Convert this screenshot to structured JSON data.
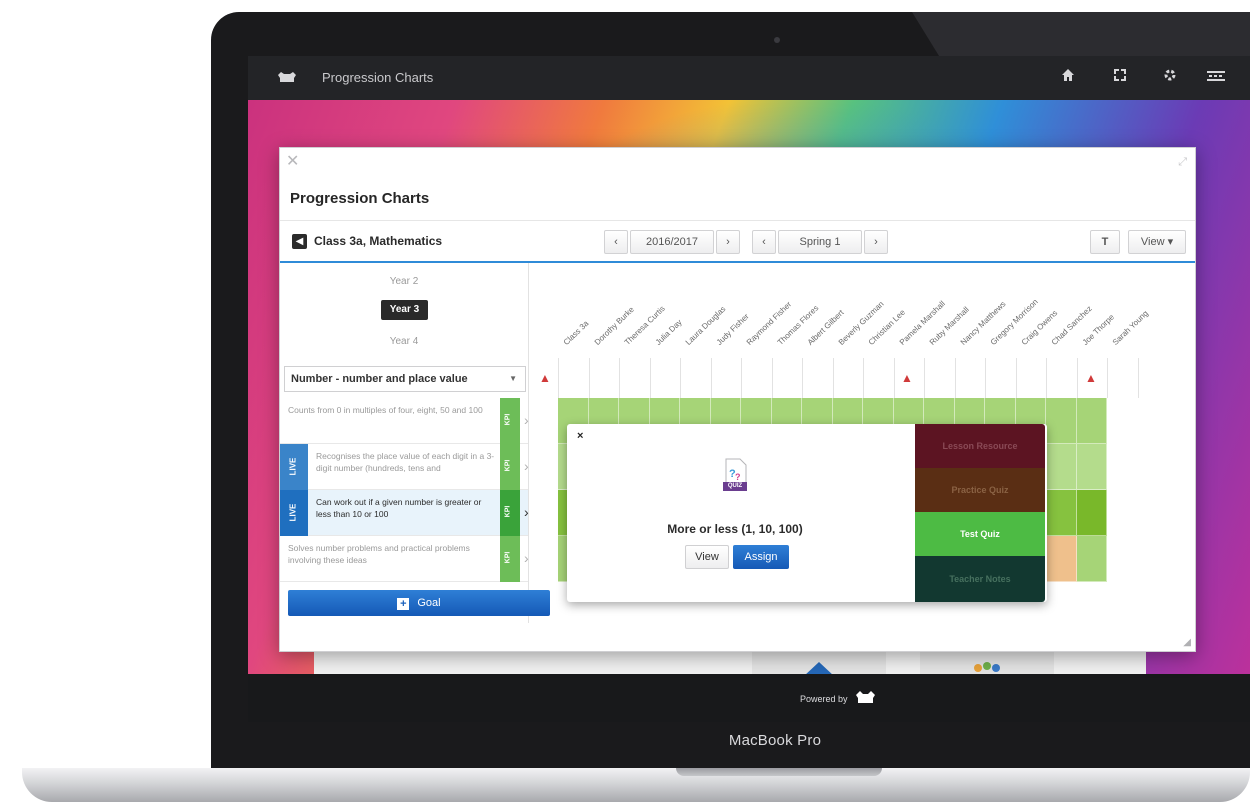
{
  "laptop": {
    "brand": "MacBook Pro"
  },
  "topbar": {
    "title": "Progression Charts",
    "icons": [
      "home-icon",
      "expand-icon",
      "settings-icon",
      "grid-icon"
    ]
  },
  "footer": {
    "powered_by": "Powered by"
  },
  "modal": {
    "title": "Progression Charts",
    "class_label": "Class 3a, Mathematics",
    "year_period": "2016/2017",
    "term": "Spring 1",
    "prev": "‹",
    "next": "›",
    "filter_label": "T",
    "view_label": "View ▾",
    "years": [
      "Year 2",
      "Year 3",
      "Year 4"
    ],
    "active_year": "Year 3",
    "topic": "Number - number and place value",
    "objectives": [
      {
        "text": "Counts from 0 in multiples of four, eight, 50 and 100",
        "live": false,
        "tag": "KPI"
      },
      {
        "text": "Recognises the place value of each digit in a 3-digit number (hundreds, tens and",
        "live": true,
        "tag": "KPI",
        "live_label": "LIVE"
      },
      {
        "text": "Can work out if a given number is greater or less than 10 or 100",
        "live": true,
        "tag": "KPI",
        "live_label": "LIVE"
      },
      {
        "text": "Solves number problems and practical problems involving these ideas",
        "live": false,
        "tag": "KPI"
      }
    ],
    "goal_label": "Goal",
    "students": [
      "Class 3a",
      "Dorothy Burke",
      "Theresa Curtis",
      "Julia Day",
      "Laura Douglas",
      "Judy Fisher",
      "Raymond Fisher",
      "Thomas Flores",
      "Albert Gilbert",
      "Beverly Guzman",
      "Christian Lee",
      "Pamela Marshall",
      "Ruby Marshall",
      "Nancy Matthews",
      "Gregory Morrison",
      "Craig Owens",
      "Chad Sanchez",
      "Joe Thorpe",
      "Sarah Young"
    ]
  },
  "popover": {
    "close": "×",
    "badge": "QUIZ",
    "title": "More or less (1, 10, 100)",
    "view_label": "View",
    "assign_label": "Assign",
    "resources": [
      {
        "label": "Lesson Resource",
        "color": "#5c1422",
        "text_color": "#8a4a56"
      },
      {
        "label": "Practice Quiz",
        "color": "#5a2e14",
        "text_color": "#8a6244"
      },
      {
        "label": "Test Quiz",
        "color": "#4dbb44",
        "text_color": "#ffffff"
      },
      {
        "label": "Teacher Notes",
        "color": "#123830",
        "text_color": "#46705e"
      }
    ]
  },
  "colors": {
    "accent_blue": "#2f8bd8",
    "progress_green": "#9fd16a",
    "progress_dark_green": "#79b82a",
    "progress_peach": "#efc08c",
    "warning_red": "#d03a3a"
  }
}
